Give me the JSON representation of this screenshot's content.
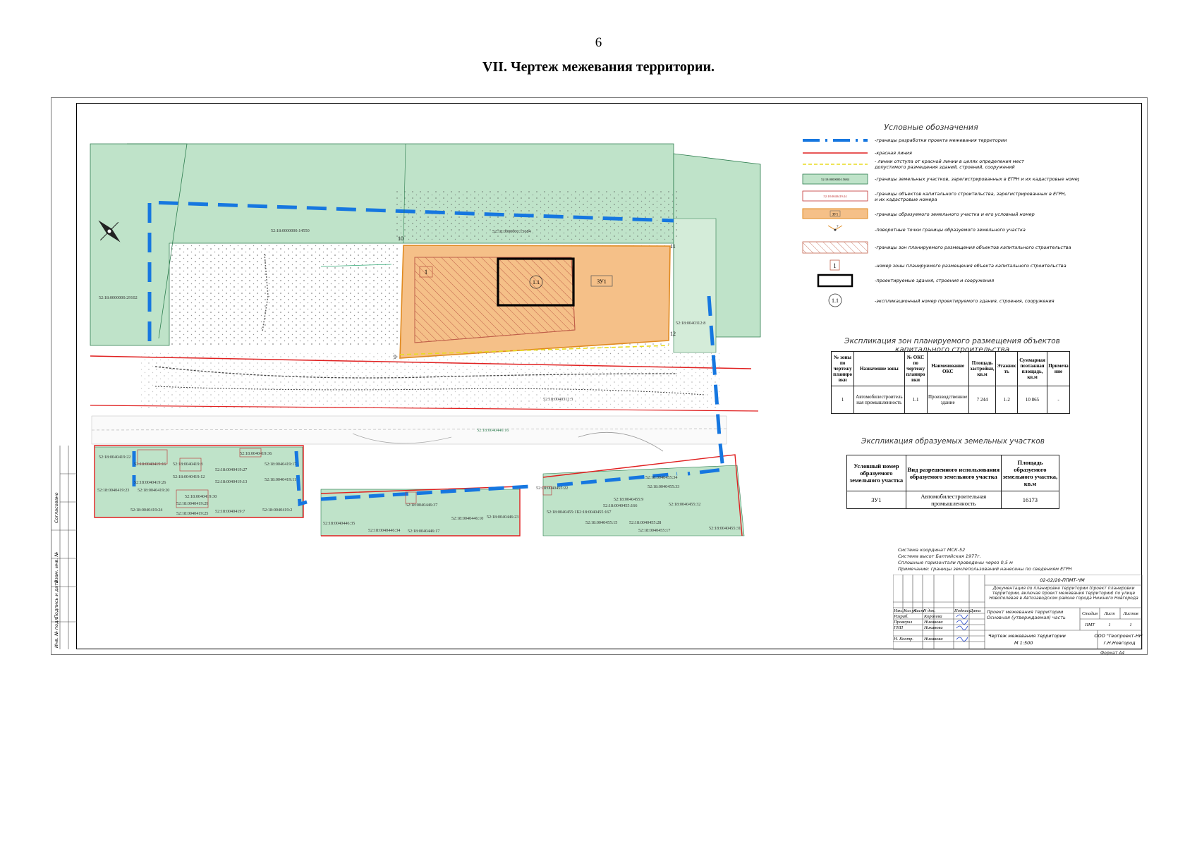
{
  "page_number": "6",
  "page_title": "VII.   Чертеж межевания территории.",
  "legend": {
    "title": "Условные обозначения",
    "items": [
      {
        "symbol": "blue-dash-line",
        "text": "-границы разработки проекта межевания территории"
      },
      {
        "symbol": "red-line",
        "text": "-красная линия"
      },
      {
        "symbol": "yellow-dash-line",
        "text": "- линии отступа от красной линии в целях определения мест",
        "text2": "допустимого размещения зданий, строений, сооружений"
      },
      {
        "symbol": "green-parcel",
        "label": "52:18:0000000:15684",
        "text": "-границы земельных участков, зарегистрированных в ЕГРН и их кадастровые номера"
      },
      {
        "symbol": "red-outline-parcel",
        "label": "52:18:0040419:24",
        "text": "-границы объектов капитального строительства, зарегистрированных в ЕГРН,",
        "text2": "и их кадастровые номера"
      },
      {
        "symbol": "orange-parcel",
        "label": "ЗУ1",
        "text": "-границы образуемого земельного участка и его условный номер"
      },
      {
        "symbol": "turning-point",
        "label": "7",
        "text": "-поворотные точки границы образуемого земельного участка"
      },
      {
        "symbol": "hatched-zone",
        "text": "-границы зон планируемого размещения объектов капитального строительства"
      },
      {
        "symbol": "zone-number",
        "label": "1",
        "text": "-номер зоны планируемого размещения объекта капитального строительства"
      },
      {
        "symbol": "bold-rect",
        "text": "-проектируемые здания, строения и сооружения"
      },
      {
        "symbol": "circle-number",
        "label": "1.1",
        "text": "-экспликационный номер проектируемого здания, строения, сооружения"
      }
    ]
  },
  "zones_table": {
    "caption": "Экспликация зон планируемого размещения объектов капитального строительства",
    "headers": [
      "№ зоны по чертежу планиро вки",
      "Назначение зоны",
      "№ ОКС по чертежу планиро вки",
      "Наименование ОКС",
      "Площадь застройки, кв.м",
      "Этажнос ть",
      "Суммарная поэтажная площадь, кв.м",
      "Примеча ние"
    ],
    "rows": [
      [
        "1",
        "Автомобилестроитель ная промышленность",
        "1.1",
        "Производственное здание",
        "7 244",
        "1-2",
        "10 865",
        "-"
      ]
    ]
  },
  "parcels_table": {
    "caption": "Экспликация образуемых земельных участков",
    "headers": [
      "Условный номер образуемого земельного участка",
      "Вид разрешенного использования образуемого земельного участка",
      "Площадь образуемого земельного участка, кв.м"
    ],
    "rows": [
      [
        "ЗУ1",
        "Автомобилестроительная промышленность",
        "16173"
      ]
    ]
  },
  "map_labels": {
    "parcel_top_left": "52:18:0000000:14550",
    "parcel_top_mid": "52:18:0000000:15684",
    "parcel_left": "52:18:0000000:29102",
    "parcel_right": "52:18:0040312:8",
    "road_parcel": "52:18:0040312:3",
    "road_parcel2": "52:18:0040446:16",
    "zu_label": "ЗУ1",
    "zone_label": "1",
    "building_label": "1.1",
    "points": [
      "9",
      "10",
      "11",
      "12"
    ],
    "bottom_left": [
      "52:18:0040419:22",
      "52:18:0040419:16",
      "52:18:0040419:8",
      "52:18:0040419:36",
      "52:18:0040419:17",
      "52:18:0040419:27",
      "52:18:0040419:12",
      "52:18:0040419:13",
      "52:18:0040419:11",
      "52:18:0040419:26",
      "52:18:0040419:23",
      "52:18:0040419:20",
      "52:18:0040419:30",
      "52:18:0040419:29",
      "52:18:0040419:24",
      "52:18:0040419:25",
      "52:18:0040419:7",
      "52:18:0040419:2"
    ],
    "bottom_mid": [
      "52:18:0040446:35",
      "52:18:0040446:34",
      "52:18:0040446:17",
      "52:18:0040446:10",
      "52:18:0040446:23",
      "52:18:0040446:37"
    ],
    "bottom_right": [
      "52:18:0040455:22",
      "52:18:0040455:34",
      "52:18:0040455:33",
      "52:18:0040455:9",
      "52:18:0040455:166",
      "52:18:0040455:32",
      "52:18:0040455:11",
      "52:18:0040455:167",
      "52:18:0040455:15",
      "52:18:0040455:28",
      "52:18:0040455:17",
      "52:18:0040455:31"
    ]
  },
  "notes": [
    "Система координат МСК-52",
    "Система высот Балтийская 1977г.",
    "Сплошные горизонтали проведены через 0,5 м",
    "Примечание: границы землепользований нанесены по сведениям ЕГРН"
  ],
  "stamp": {
    "code": "02-02/20-ППМТ-ЧМ",
    "description": "Документация по планировке территории (проект планировки территории, включая проект межевания территории) по улице Новополевая в Автозаводском районе города Нижнего Новгорода",
    "header_cols": [
      "Изм.",
      "Кол.уч",
      "Лист",
      "N док.",
      "Подпись",
      "Дата"
    ],
    "rows": [
      {
        "role": "Разраб.",
        "name": "Королева"
      },
      {
        "role": "Проверил",
        "name": "Никанова"
      },
      {
        "role": "ГИП",
        "name": "Никанова"
      },
      {
        "role": "Н. Контр.",
        "name": "Никанова"
      }
    ],
    "section_title": "Проект межевания территории Основная (утверждаемая) часть",
    "stage_headers": [
      "Стадия",
      "Лист",
      "Листов"
    ],
    "stage_values": [
      "ПМТ",
      "1",
      "1"
    ],
    "drawing_title": "Чертеж межевания территории",
    "scale": "М 1:500",
    "company": "ООО \"Геопроект-НН\"",
    "city": "г.Н.Новгород",
    "format": "Формат А4"
  },
  "side_stamp": [
    "Согласовано",
    "Взам. инв. №",
    "Подпись и дата",
    "Инв. № подл."
  ],
  "colors": {
    "parcel_green": "#bfe3c9",
    "zu_orange": "#f5c088",
    "project_blue": "#1677e0",
    "red_line": "#e02020",
    "yellow_line": "#e8dc20"
  }
}
